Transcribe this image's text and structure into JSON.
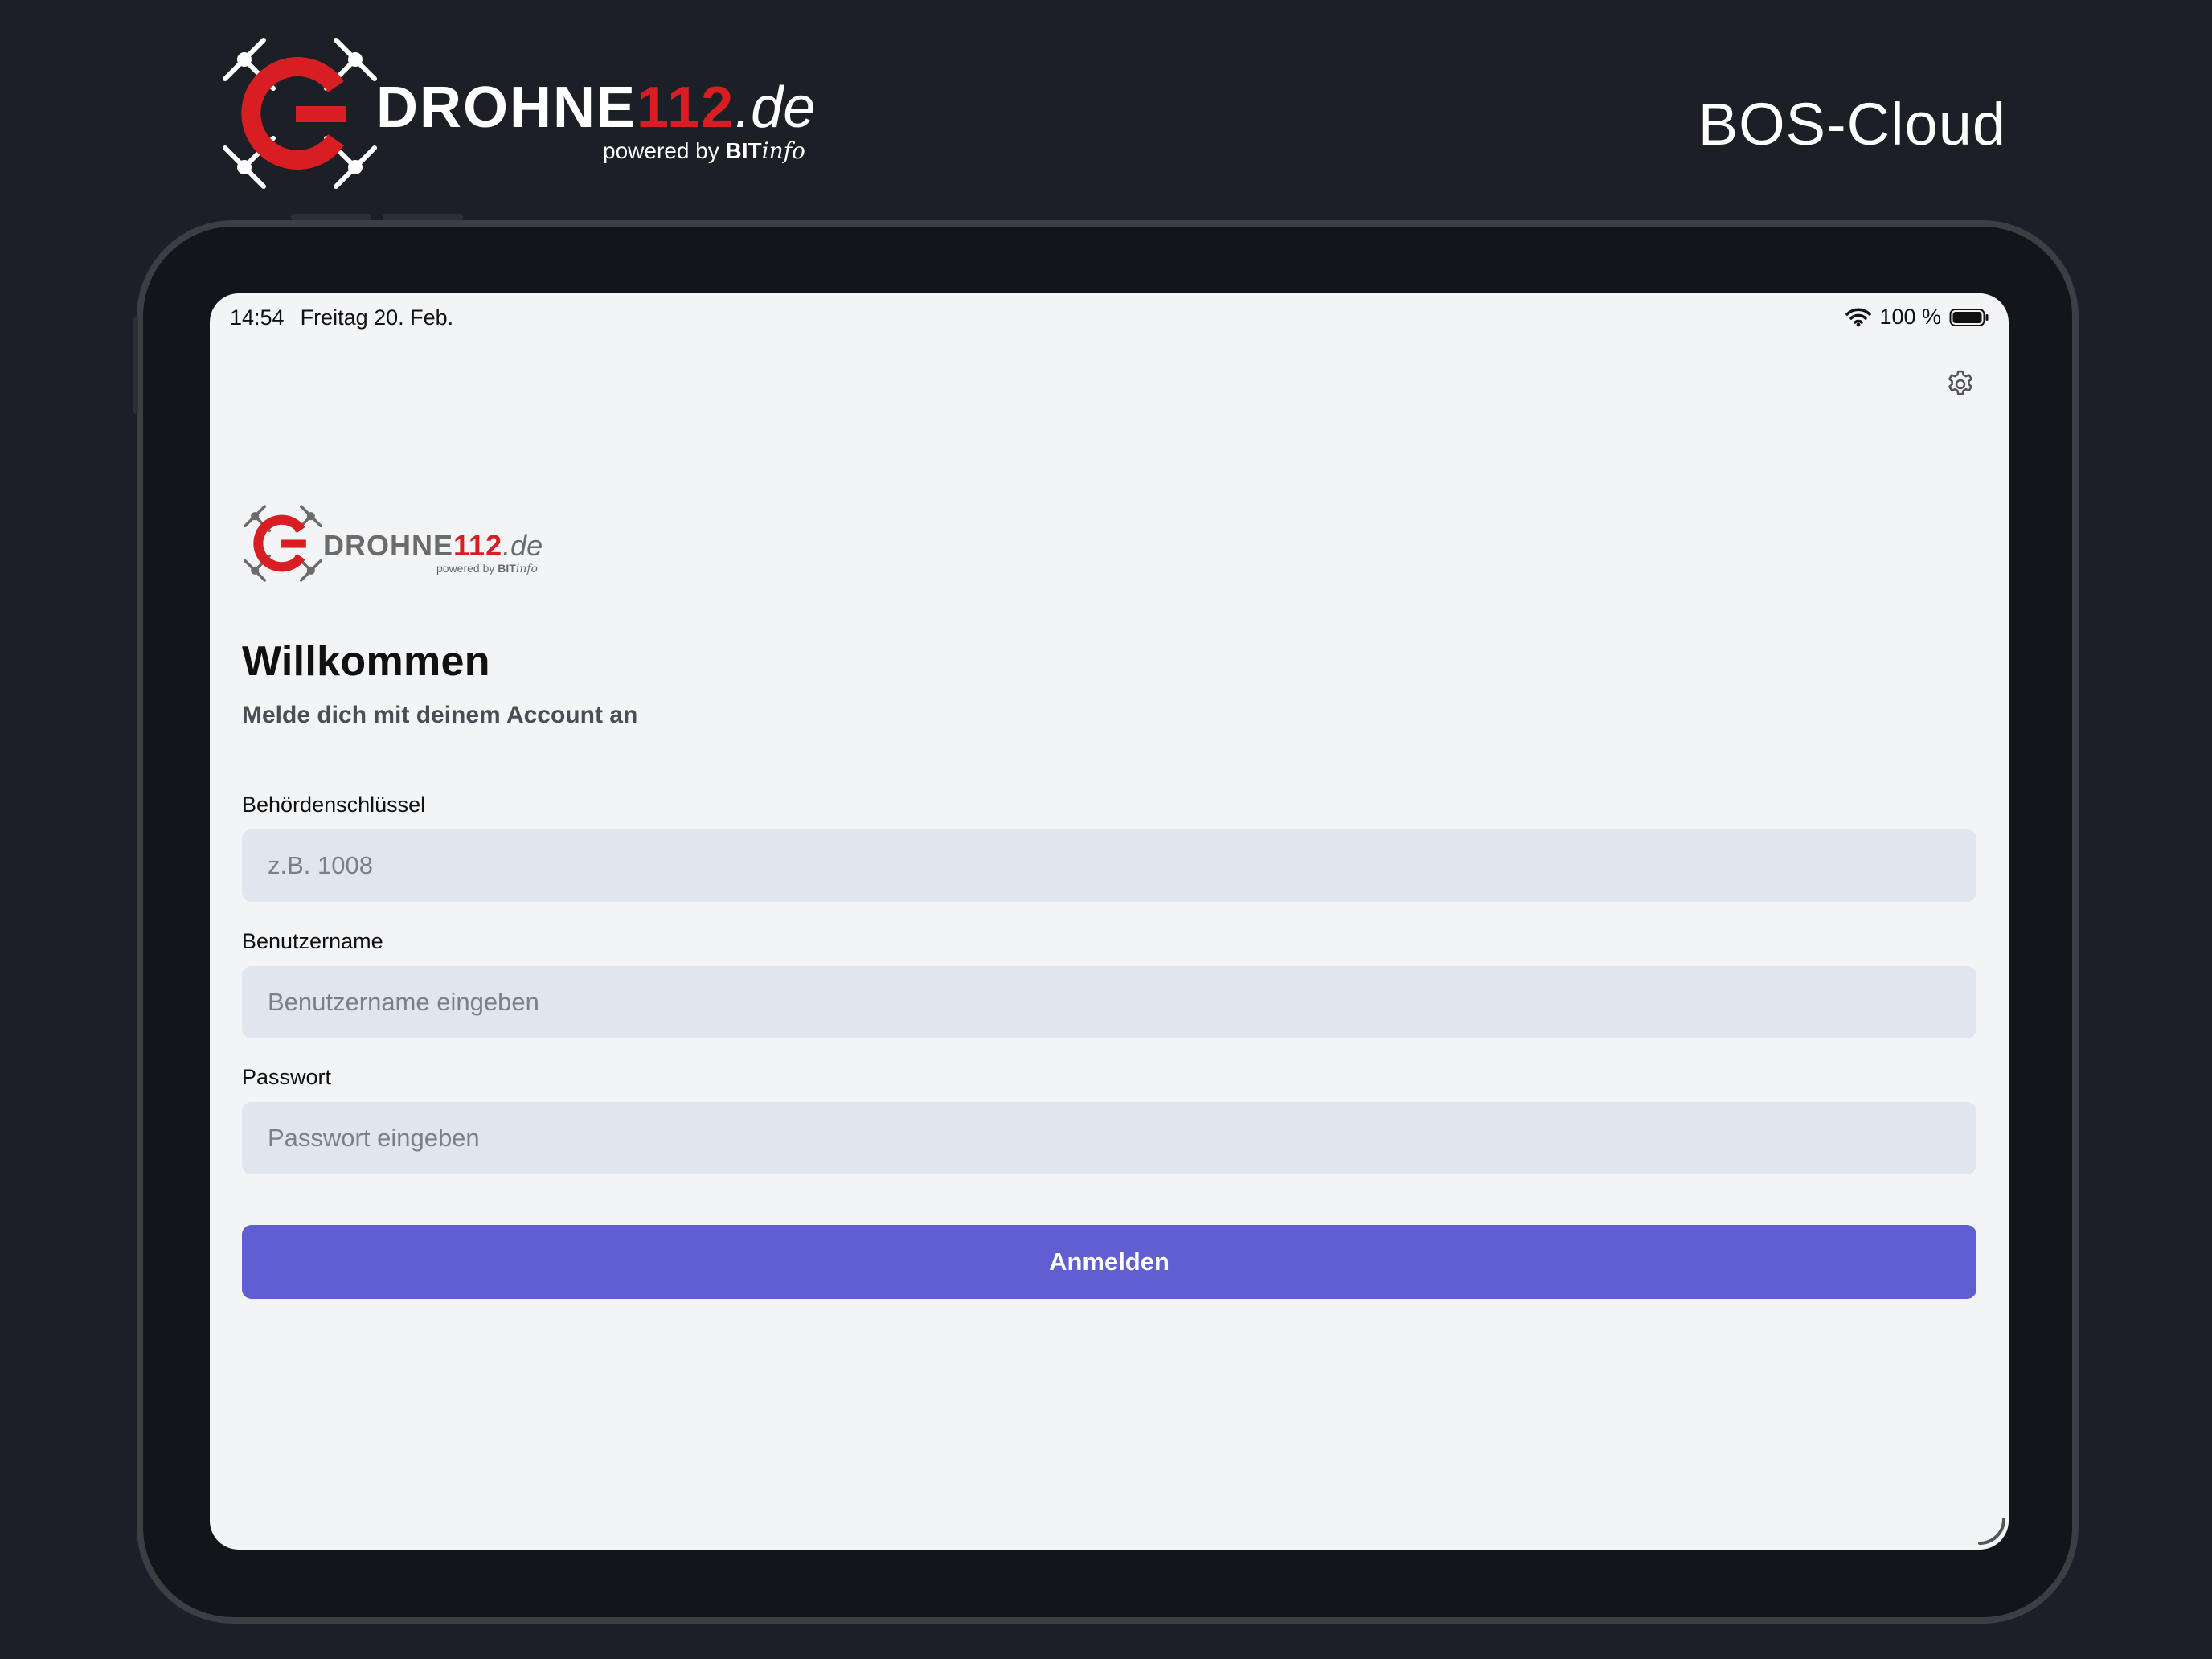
{
  "brand": {
    "word_main": "DROHNE",
    "word_number": "112",
    "word_tld": ".de",
    "powered_prefix": "powered by ",
    "powered_brand_bold": "BIT",
    "powered_brand_italic": "info",
    "accent_color": "#d81e23"
  },
  "header": {
    "product_title": "BOS-Cloud"
  },
  "status_bar": {
    "time": "14:54",
    "date": "Freitag 20. Feb.",
    "battery_text": "100 %",
    "wifi_icon": "wifi-icon",
    "battery_icon": "battery-full-icon"
  },
  "app": {
    "settings_icon": "gear-icon",
    "logo": {
      "word_main": "DROHNE",
      "word_number": "112",
      "word_tld": ".de",
      "powered_prefix": "powered by ",
      "powered_brand_bold": "BIT",
      "powered_brand_italic": "info"
    },
    "title": "Willkommen",
    "subtitle": "Melde dich mit deinem Account an",
    "form": {
      "authority_key": {
        "label": "Behördenschlüssel",
        "value": "",
        "placeholder": "z.B. 1008"
      },
      "username": {
        "label": "Benutzername",
        "value": "",
        "placeholder": "Benutzername eingeben"
      },
      "password": {
        "label": "Passwort",
        "value": "",
        "placeholder": "Passwort eingeben"
      },
      "submit_label": "Anmelden",
      "submit_color": "#605ed0"
    }
  }
}
